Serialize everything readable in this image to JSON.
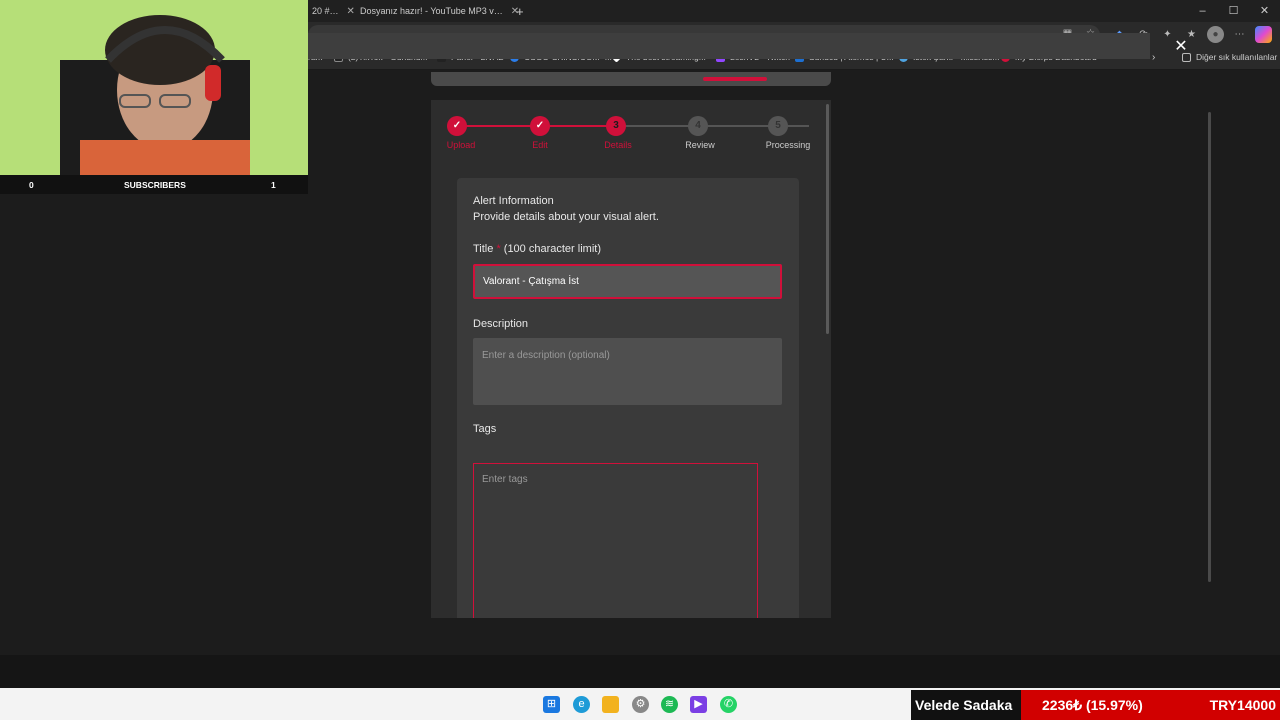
{
  "tabs": [
    {
      "label": "20 #…"
    },
    {
      "label": "Dosyanız hazır! - YouTube MP3 v…"
    }
  ],
  "new_tab_symbol": "+",
  "window_controls": [
    "–",
    "☐",
    "✕"
  ],
  "bookmarks": [
    {
      "label": "ram"
    },
    {
      "label": "(2)TikTok - Gününü..."
    },
    {
      "label": "Panel • LIVAD"
    },
    {
      "label": "CSGO-SKINS.COM -..."
    },
    {
      "label": "The best streaming..."
    },
    {
      "label": "LeshVL - Twitch"
    },
    {
      "label": "Sunucu | Aternos | Ü..."
    },
    {
      "label": "İstek Şarkı - MissXss..."
    },
    {
      "label": "My Blerps Dashboard"
    }
  ],
  "bookmarks_more": "Diğer sık kullanılanlar",
  "modal_close": "✕",
  "steps": [
    {
      "label": "Upload",
      "symbol": "✓"
    },
    {
      "label": "Edit",
      "symbol": "✓"
    },
    {
      "label": "Details",
      "symbol": "3"
    },
    {
      "label": "Review",
      "symbol": "4"
    },
    {
      "label": "Processing",
      "symbol": "5"
    }
  ],
  "form": {
    "section_title": "Alert Information",
    "section_subtitle": "Provide details about your visual alert.",
    "title_label": "Title",
    "title_required": "*",
    "title_limit": "(100 character limit)",
    "title_value": "Valorant - Çatışma İst",
    "description_label": "Description",
    "description_placeholder": "Enter a description (optional)",
    "tags_label": "Tags",
    "tags_placeholder": "Enter tags"
  },
  "webcam": {
    "left_count": "0",
    "label": "SUBSCRIBERS",
    "right_count": "1"
  },
  "ticker": {
    "name": "Velede Sadaka",
    "change": "2236₺ (15.97%)",
    "price": "TRY14000"
  }
}
